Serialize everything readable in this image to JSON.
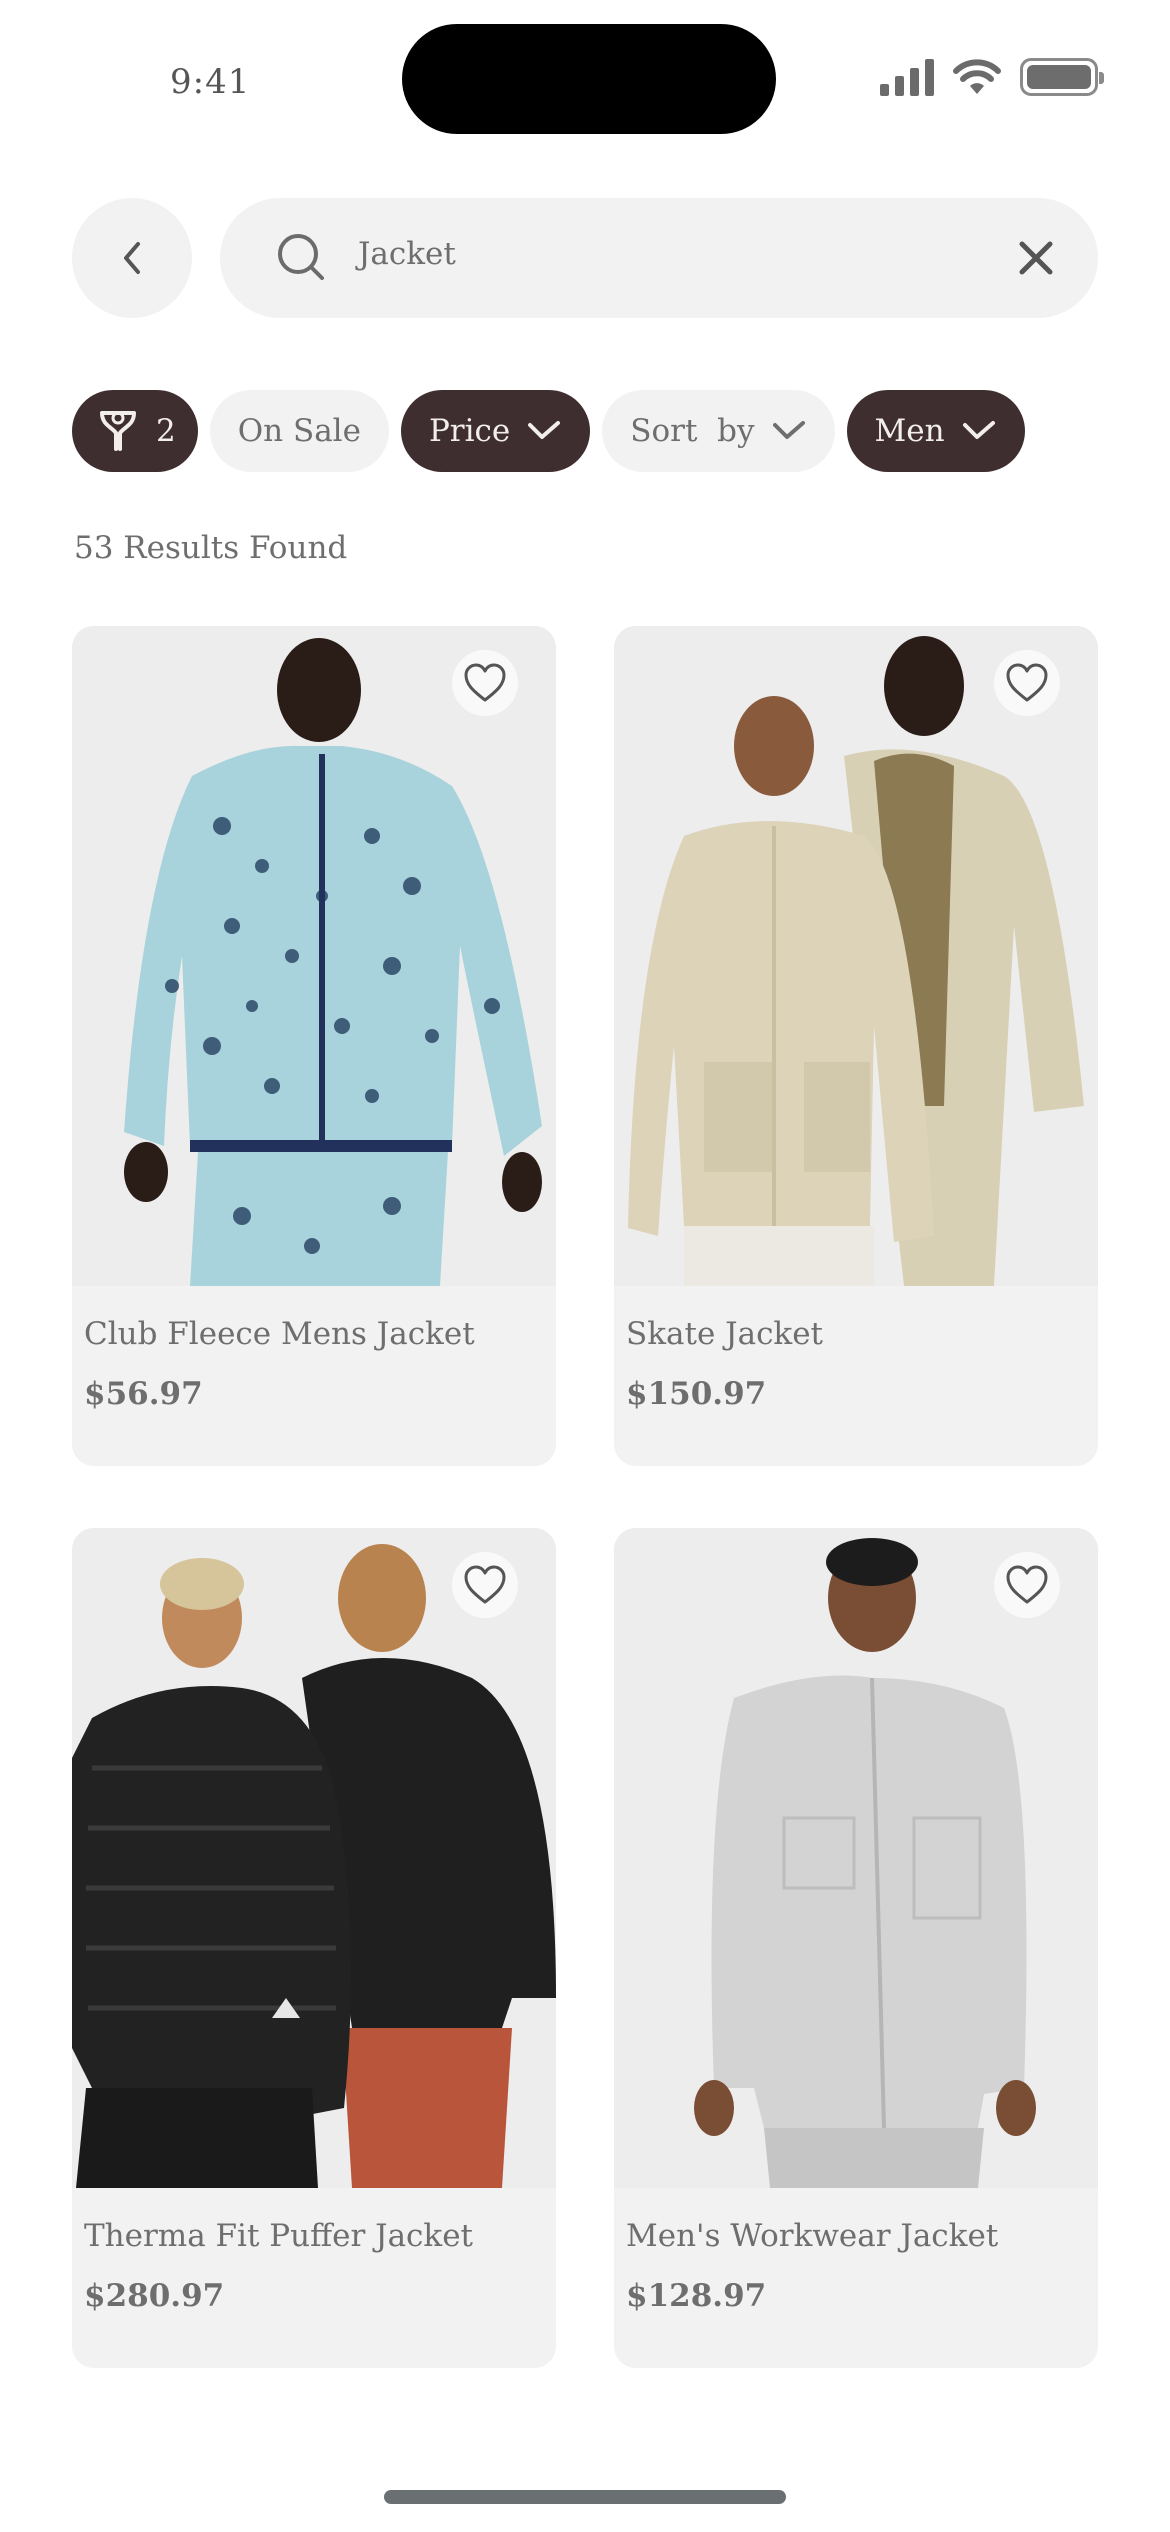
{
  "status": {
    "time": "9:41"
  },
  "search": {
    "query": "Jacket"
  },
  "filters": {
    "active_count": "2",
    "on_sale": "On Sale",
    "price": "Price",
    "sort_by": "Sort  by",
    "gender": "Men"
  },
  "results_label": "53 Results Found",
  "products": [
    {
      "name": "Club Fleece Mens Jacket",
      "price": "$56.97"
    },
    {
      "name": "Skate Jacket",
      "price": "$150.97"
    },
    {
      "name": "Therma Fit Puffer Jacket",
      "price": "$280.97"
    },
    {
      "name": "Men's Workwear Jacket",
      "price": "$128.97"
    }
  ],
  "colors": {
    "accent_dark": "#3f2e30",
    "surface": "#f2f2f2",
    "text": "#6e6e6e"
  }
}
